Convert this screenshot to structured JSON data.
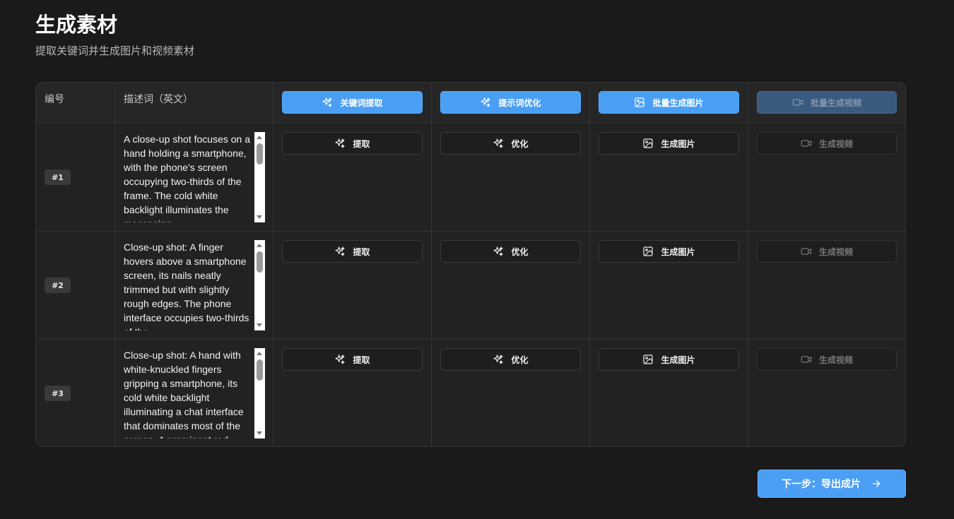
{
  "page": {
    "title": "生成素材",
    "subtitle": "提取关键词并生成图片和视频素材"
  },
  "table": {
    "headers": {
      "id": "编号",
      "desc": "描述词（英文）",
      "extract_all": "关键词提取",
      "optimize_all": "提示词优化",
      "image_all": "批量生成图片",
      "video_all": "批量生成视频"
    },
    "row_actions": {
      "extract": "提取",
      "optimize": "优化",
      "image": "生成图片",
      "video": "生成视频"
    },
    "rows": [
      {
        "id": "#1",
        "description": "A close-up shot focuses on a hand holding a smartphone, with the phone's screen occupying two-thirds of the frame. The cold white backlight illuminates the messaging"
      },
      {
        "id": "#2",
        "description": "Close-up shot: A finger hovers above a smartphone screen, its nails neatly trimmed but with slightly rough edges. The phone interface occupies two-thirds of the"
      },
      {
        "id": "#3",
        "description": "Close-up shot: A hand with white-knuckled fingers gripping a smartphone, its cold white backlight illuminating a chat interface that dominates most of the screen. A prominent red"
      }
    ]
  },
  "footer": {
    "next_label": "下一步：导出成片"
  },
  "icons": {
    "extract": "sparkles-icon",
    "optimize": "sparkles-icon",
    "image": "image-icon",
    "video": "video-icon",
    "next": "arrow-right-icon"
  },
  "colors": {
    "background": "#1a1a1a",
    "accent": "#4a9ff5",
    "disabled_accent": "#3a5a80"
  }
}
